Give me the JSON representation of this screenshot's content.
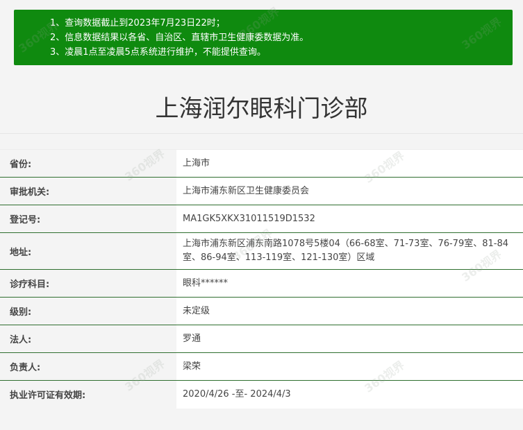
{
  "notice": {
    "lines": [
      "1、查询数据截止到2023年7月23日22时；",
      "2、信息数据结果以各省、自治区、直辖市卫生健康委数据为准。",
      "3、凌晨1点至凌晨5点系统进行维护，不能提供查询。"
    ]
  },
  "title": "上海润尔眼科门诊部",
  "rows": [
    {
      "label": "省份:",
      "value": "上海市"
    },
    {
      "label": "审批机关:",
      "value": "上海市浦东新区卫生健康委员会"
    },
    {
      "label": "登记号:",
      "value": "MA1GK5XKX31011519D1532"
    },
    {
      "label": "地址:",
      "value": "上海市浦东新区浦东南路1078号5楼04（66-68室、71-73室、76-79室、81-84室、86-94室、113-119室、121-130室）区域"
    },
    {
      "label": "诊疗科目:",
      "value": "眼科******"
    },
    {
      "label": "级别:",
      "value": "未定级"
    },
    {
      "label": "法人:",
      "value": "罗通"
    },
    {
      "label": "负责人:",
      "value": "梁荣"
    },
    {
      "label": "执业许可证有效期:",
      "value": "2020/4/26 -至- 2024/4/3"
    }
  ],
  "watermark": "360视界",
  "colors": {
    "notice_bg": "#0f8a0f",
    "row_divider": "#2e6e2e"
  }
}
